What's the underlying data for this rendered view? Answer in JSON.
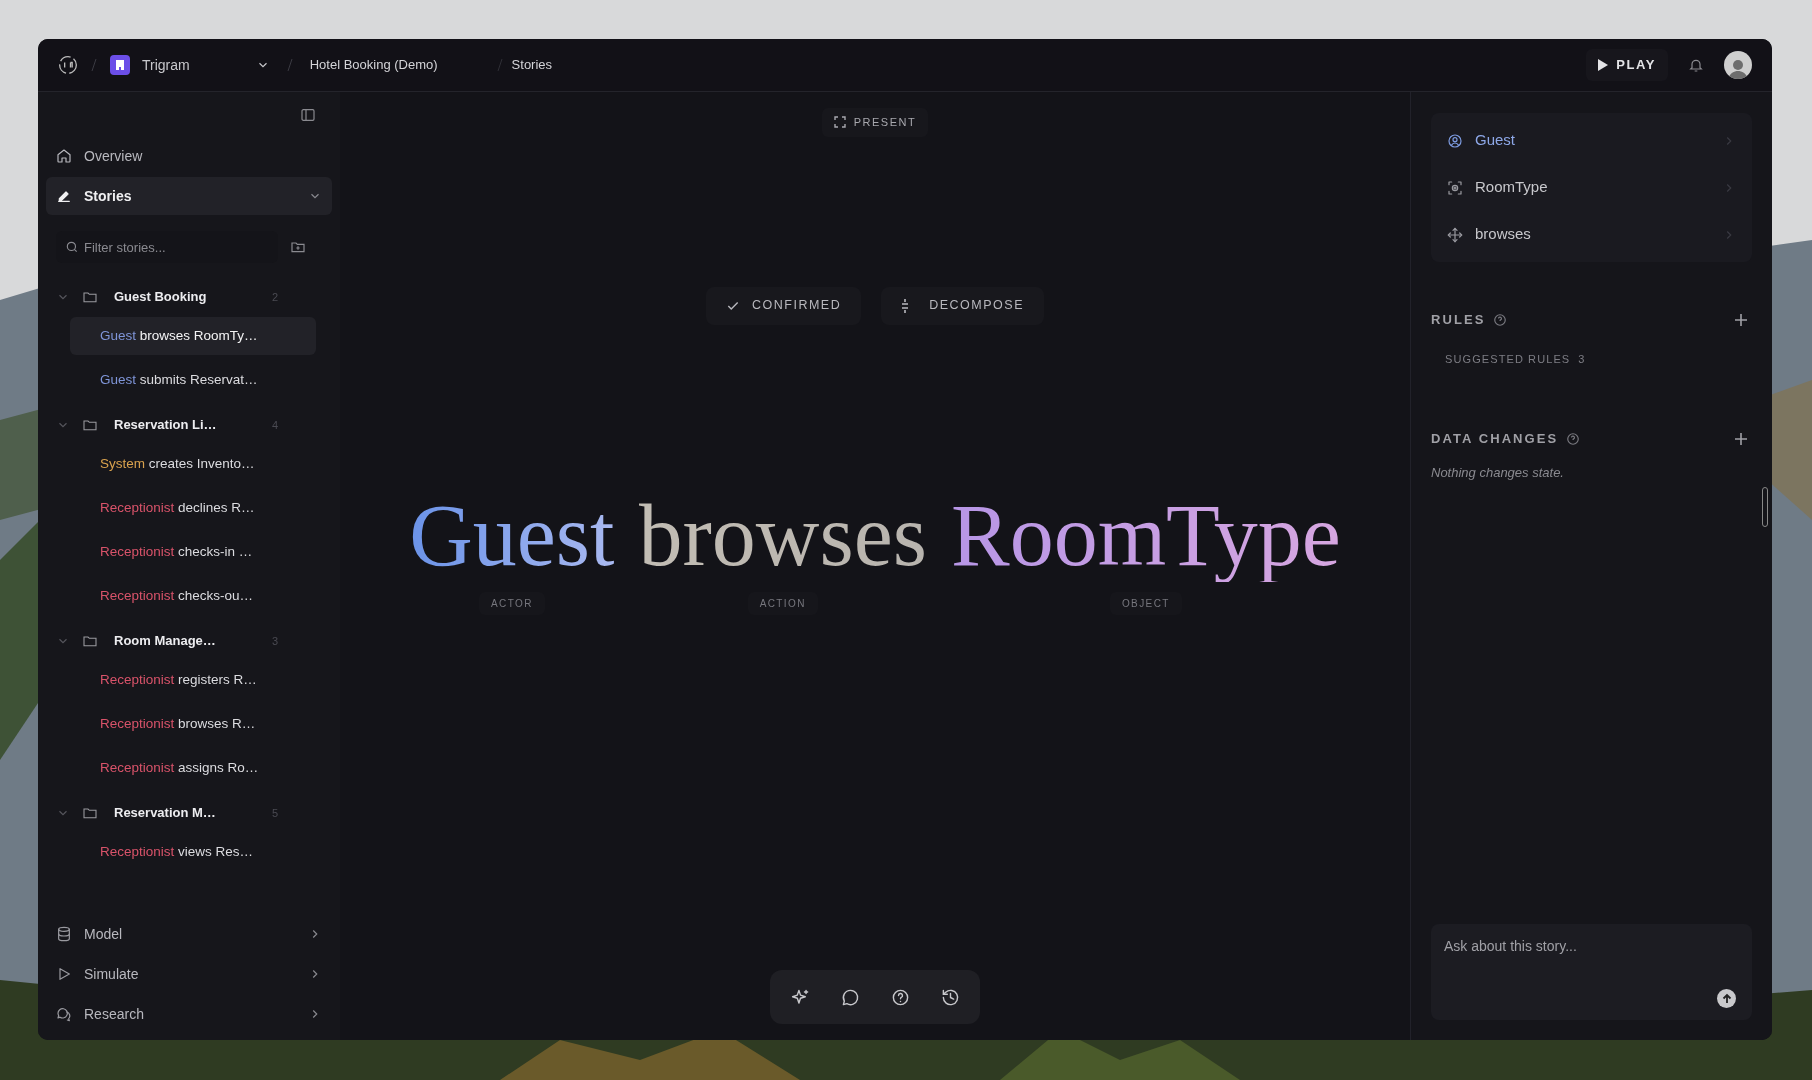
{
  "header": {
    "workspace": "Trigram",
    "project": "Hotel Booking (Demo)",
    "page": "Stories",
    "play": "PLAY"
  },
  "sidebar": {
    "nav": [
      {
        "label": "Overview",
        "selected": false,
        "expanded": false
      },
      {
        "label": "Stories",
        "selected": true,
        "expanded": true
      }
    ],
    "filter": {
      "placeholder": "Filter stories..."
    },
    "groups": [
      {
        "name": "Guest Booking",
        "count": "2",
        "expanded": true,
        "stories": [
          {
            "actor": "Guest",
            "text": "browses RoomTy…",
            "color": "#7f95d8",
            "selected": true
          },
          {
            "actor": "Guest",
            "text": "submits Reservat…",
            "color": "#7f95d8",
            "selected": false
          }
        ]
      },
      {
        "name": "Reservation Li…",
        "count": "4",
        "expanded": true,
        "stories": [
          {
            "actor": "System",
            "text": "creates Invento…",
            "color": "#d9a24e",
            "selected": false
          },
          {
            "actor": "Receptionist",
            "text": "declines R…",
            "color": "#d9536a",
            "selected": false
          },
          {
            "actor": "Receptionist",
            "text": "checks-in …",
            "color": "#d9536a",
            "selected": false
          },
          {
            "actor": "Receptionist",
            "text": "checks-ou…",
            "color": "#d9536a",
            "selected": false
          }
        ]
      },
      {
        "name": "Room Manage…",
        "count": "3",
        "expanded": true,
        "stories": [
          {
            "actor": "Receptionist",
            "text": "registers R…",
            "color": "#d9536a",
            "selected": false
          },
          {
            "actor": "Receptionist",
            "text": "browses R…",
            "color": "#d9536a",
            "selected": false
          },
          {
            "actor": "Receptionist",
            "text": "assigns Ro…",
            "color": "#d9536a",
            "selected": false
          }
        ]
      },
      {
        "name": "Reservation M…",
        "count": "5",
        "expanded": true,
        "stories": [
          {
            "actor": "Receptionist",
            "text": "views Res…",
            "color": "#d9536a",
            "selected": false
          }
        ]
      }
    ],
    "bottom_nav": [
      {
        "label": "Model"
      },
      {
        "label": "Simulate"
      },
      {
        "label": "Research"
      }
    ]
  },
  "story": {
    "present": "PRESENT",
    "status": "CONFIRMED",
    "decompose": "DECOMPOSE",
    "parts": [
      {
        "word": "Guest",
        "role": "ACTOR",
        "kind": "actor"
      },
      {
        "word": "browses",
        "role": "ACTION",
        "kind": "action"
      },
      {
        "word": "RoomType",
        "role": "OBJECT",
        "kind": "object"
      }
    ]
  },
  "inspector": {
    "entities": [
      {
        "label": "Guest",
        "kind": "actor",
        "selected": true
      },
      {
        "label": "RoomType",
        "kind": "object",
        "selected": false
      },
      {
        "label": "browses",
        "kind": "action",
        "selected": false
      }
    ],
    "rules": {
      "title": "RULES",
      "suggested": "SUGGESTED RULES",
      "suggested_count": "3"
    },
    "data_changes": {
      "title": "DATA CHANGES",
      "empty": "Nothing changes state."
    },
    "chat": {
      "placeholder": "Ask about this story..."
    }
  }
}
